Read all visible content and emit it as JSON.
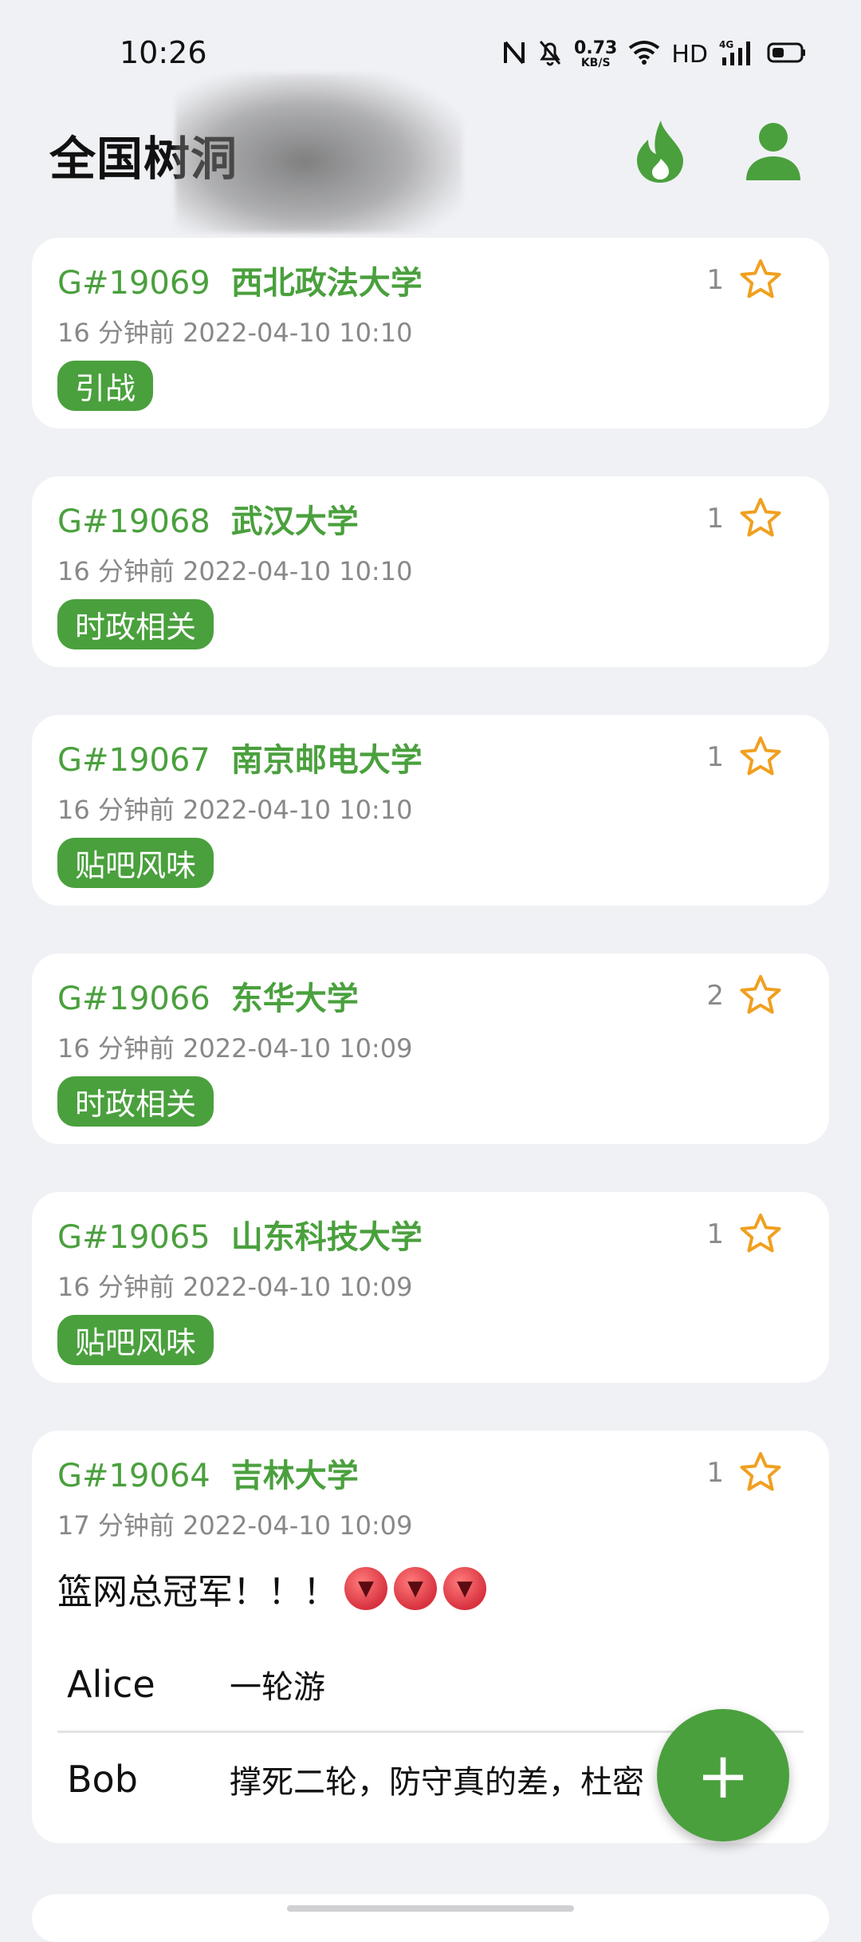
{
  "status_bar": {
    "time": "10:26",
    "net_speed_value": "0.73",
    "net_speed_unit": "KB/S",
    "hd_label": "HD",
    "network_label": "4G",
    "icons": [
      "nfc-icon",
      "mute-icon",
      "wifi-icon",
      "signal-icon",
      "battery-icon"
    ]
  },
  "header": {
    "title": "全国树洞",
    "icons": [
      "fire-icon",
      "user-icon"
    ]
  },
  "colors": {
    "accent": "#4aa03d",
    "star": "#f0a020",
    "background": "#f0f1f5"
  },
  "posts": [
    {
      "id": "G#19069",
      "school": "西北政法大学",
      "meta": "16 分钟前 2022-04-10 10:10",
      "tag": "引战",
      "favorites": "1"
    },
    {
      "id": "G#19068",
      "school": "武汉大学",
      "meta": "16 分钟前 2022-04-10 10:10",
      "tag": "时政相关",
      "favorites": "1"
    },
    {
      "id": "G#19067",
      "school": "南京邮电大学",
      "meta": "16 分钟前 2022-04-10 10:10",
      "tag": "贴吧风味",
      "favorites": "1"
    },
    {
      "id": "G#19066",
      "school": "东华大学",
      "meta": "16 分钟前 2022-04-10 10:09",
      "tag": "时政相关",
      "favorites": "2"
    },
    {
      "id": "G#19065",
      "school": "山东科技大学",
      "meta": "16 分钟前 2022-04-10 10:09",
      "tag": "贴吧风味",
      "favorites": "1"
    },
    {
      "id": "G#19064",
      "school": "吉林大学",
      "meta": "17 分钟前 2022-04-10 10:09",
      "favorites": "1",
      "text": "篮网总冠军！！！",
      "comments": [
        {
          "name": "Alice",
          "text": "一轮游"
        },
        {
          "name": "Bob",
          "text": "撑死二轮，防守真的差，杜密"
        }
      ]
    }
  ],
  "fab": {
    "label": "+"
  }
}
